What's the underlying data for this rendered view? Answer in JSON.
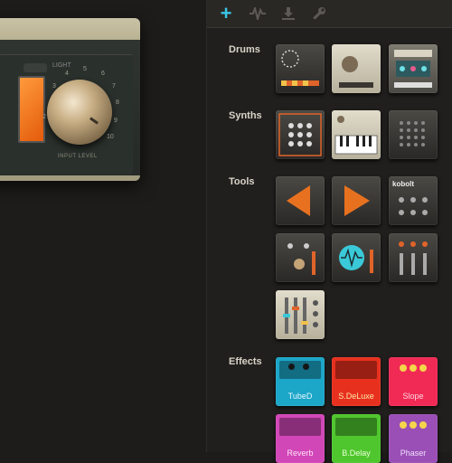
{
  "device": {
    "toggle_label": "LIGHT",
    "dial_numbers": [
      "4",
      "5",
      "6",
      "3",
      "7",
      "8",
      "9",
      "10",
      "2"
    ],
    "knob_caption": "INPUT LEVEL"
  },
  "toolbar": {
    "add_icon": "plus-icon",
    "wave_icon": "waveform-icon",
    "download_icon": "download-icon",
    "wrench_icon": "wrench-icon"
  },
  "sections": {
    "drums": "Drums",
    "synths": "Synths",
    "tools": "Tools",
    "effects": "Effects"
  },
  "tiles": {
    "kobolt": "kobolt",
    "tubed": "TubeD",
    "sdeluxe": "S.DeLuxe",
    "slope": "Slope",
    "reverb": "Reverb",
    "bdelay": "B.Delay",
    "phaser": "Phaser"
  },
  "colors": {
    "accent": "#39c6e6",
    "tubed": "#1ca6c8",
    "sdeluxe": "#e8301f",
    "slope": "#f02a55",
    "reverb": "#d247b8",
    "bdelay": "#4fc62e",
    "phaser": "#9a4fb6"
  }
}
